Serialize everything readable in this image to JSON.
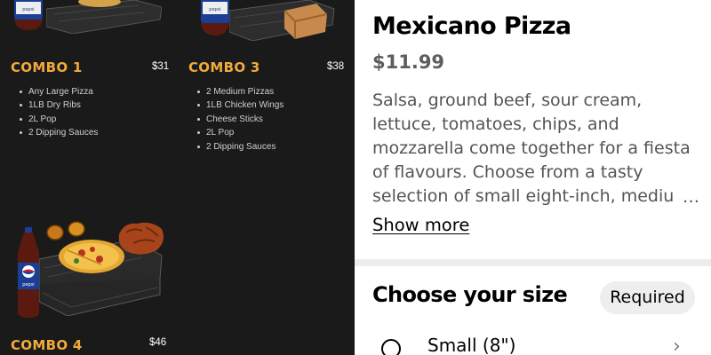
{
  "menu": {
    "combos": [
      {
        "title": "COMBO 1",
        "price": "$31",
        "items": [
          "Any Large Pizza",
          "1LB Dry Ribs",
          "2L Pop",
          "2 Dipping Sauces"
        ]
      },
      {
        "title": "COMBO 3",
        "price": "$38",
        "items": [
          "2 Medium Pizzas",
          "1LB Chicken Wings",
          "Cheese Sticks",
          "2L Pop",
          "2 Dipping Sauces"
        ]
      },
      {
        "title": "COMBO 4",
        "price": "$46"
      }
    ],
    "colors": {
      "background": "#1a1a1a",
      "combo_title": "#f2a93b"
    },
    "icons": [
      "pop-bottle-icon",
      "pizza-box-icon",
      "takeout-box-icon",
      "pizza-icon",
      "dipping-sauce-icon",
      "chicken-wings-icon"
    ]
  },
  "item": {
    "title": "Mexicano Pizza",
    "price": "$11.99",
    "description": "Salsa, ground beef, sour cream, lettuce, tomatoes, chips, and mozzarella come together for a fiesta of flavours. Choose from a tasty selection of small eight-inch, mediu",
    "show_more": "Show more"
  },
  "size_section": {
    "title": "Choose your size",
    "badge": "Required",
    "options": [
      {
        "label": "Small (8\")"
      }
    ]
  }
}
